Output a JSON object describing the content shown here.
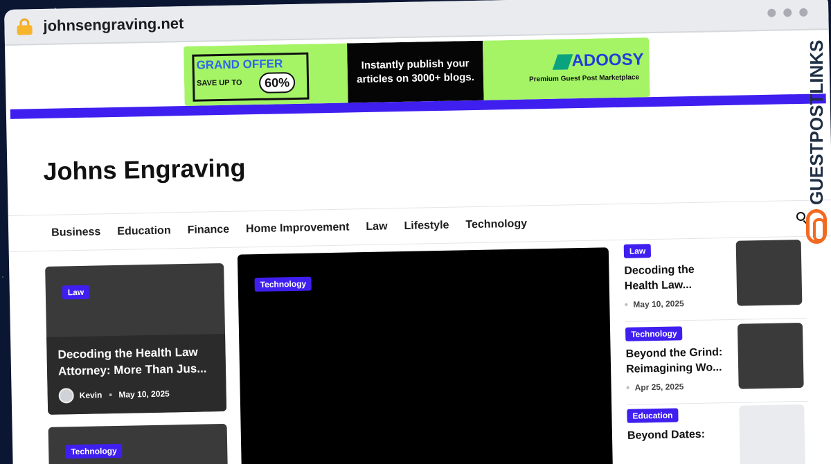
{
  "browser": {
    "url": "johnsengraving.net"
  },
  "ad": {
    "grand": "GRAND",
    "offer": "OFFER",
    "save": "SAVE UP TO",
    "percent": "60%",
    "middle": "Instantly publish your articles on 3000+ blogs.",
    "brand": "ADOOSY",
    "tagline": "Premium Guest Post Marketplace"
  },
  "site": {
    "title": "Johns Engraving"
  },
  "nav": {
    "items": [
      "Business",
      "Education",
      "Finance",
      "Home Improvement",
      "Law",
      "Lifestyle",
      "Technology"
    ]
  },
  "featured": {
    "badge": "Law",
    "title": "Decoding the Health Law Attorney: More Than Jus...",
    "author": "Kevin",
    "date": "May 10, 2025",
    "second_badge": "Technology"
  },
  "hero": {
    "badge": "Technology"
  },
  "sidebar": {
    "items": [
      {
        "badge": "Law",
        "title": "Decoding the Health Law...",
        "date": "May 10, 2025"
      },
      {
        "badge": "Technology",
        "title": "Beyond the Grind: Reimagining Wo...",
        "date": "Apr 25, 2025"
      },
      {
        "badge": "Education",
        "title": "Beyond Dates:",
        "date": ""
      }
    ]
  },
  "watermark": {
    "text": "GUESTPOSTLINKS"
  },
  "colors": {
    "accent": "#3f1ff0",
    "ad_green": "#a4f466",
    "watermark_orange": "#f26a21"
  }
}
